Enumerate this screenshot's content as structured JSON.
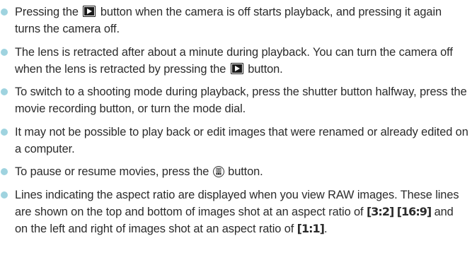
{
  "colors": {
    "bullet": "#9fd3df",
    "text": "#2b2b2b"
  },
  "icons": {
    "playback": "playback-button-icon",
    "func_set": "func-set-button-icon"
  },
  "notes": [
    {
      "a": "Pressing the ",
      "b": " button when the camera is off starts playback, and pressing it again turns the camera off."
    },
    {
      "a": "The lens is retracted after about a minute during playback. You can turn the camera off when the lens is retracted by pressing the ",
      "b": " button."
    },
    {
      "text": "To switch to a shooting mode during playback, press the shutter button halfway, press the movie recording button, or turn the mode dial."
    },
    {
      "text": "It may not be possible to play back or edit images that were renamed or already edited on a computer."
    },
    {
      "a": "To pause or resume movies, press the ",
      "b": " button."
    },
    {
      "a": "Lines indicating the aspect ratio are displayed when you view RAW images. These lines are shown on the top and bottom of images shot at an aspect ratio of ",
      "ratio1": "[3:2]",
      "ratio2": "[16:9]",
      "b": " and on the left and right of images shot at an aspect ratio of ",
      "ratio3": "[1:1]",
      "c": "."
    }
  ]
}
